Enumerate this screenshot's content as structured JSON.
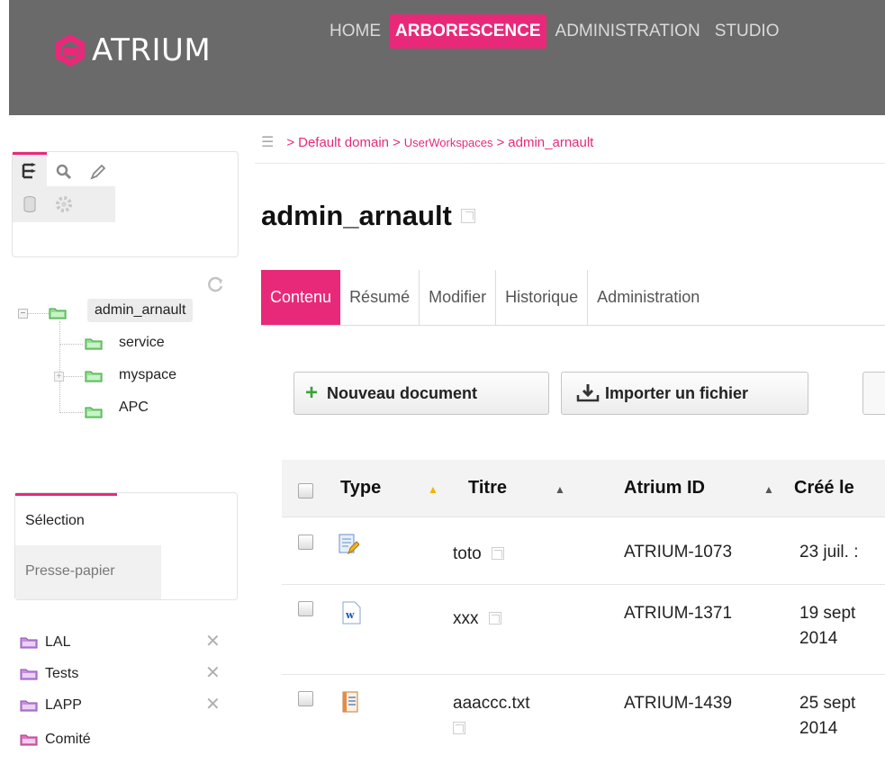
{
  "header": {
    "logo_text": "ATRIUM",
    "nav": [
      {
        "label": "HOME",
        "active": false
      },
      {
        "label": "ARBORESCENCE",
        "active": true
      },
      {
        "label": "ADMINISTRATION",
        "active": false
      },
      {
        "label": "STUDIO",
        "active": false
      }
    ]
  },
  "sidebar": {
    "tools": [
      "tree-icon",
      "search-icon",
      "pencil-icon",
      "database-icon",
      "settings-gear-icon"
    ],
    "tree": {
      "root": "admin_arnault",
      "children": [
        "service",
        "myspace",
        "APC"
      ]
    },
    "selection_tabs": {
      "active": "Sélection",
      "inactive": "Presse-papier"
    },
    "selection_items": [
      "LAL",
      "Tests",
      "LAPP",
      "Comité"
    ]
  },
  "breadcrumb": {
    "prefix": ">",
    "items": [
      "Default domain",
      "UserWorkspaces",
      "admin_arnault"
    ]
  },
  "page": {
    "title": "admin_arnault"
  },
  "tabs": [
    "Contenu",
    "Résumé",
    "Modifier",
    "Historique",
    "Administration"
  ],
  "actions": {
    "new_document": "Nouveau document",
    "import_file": "Importer un fichier"
  },
  "table": {
    "columns": [
      "Type",
      "Titre",
      "Atrium ID",
      "Créé le"
    ],
    "rows": [
      {
        "type_icon": "note-edit-icon",
        "title": "toto",
        "id": "ATRIUM-1073",
        "created": "23 juil. :"
      },
      {
        "type_icon": "word-document-icon",
        "title": "xxx",
        "id": "ATRIUM-1371",
        "created_line1": "19 sept",
        "created_line2": "2014"
      },
      {
        "type_icon": "text-file-icon",
        "title": "aaaccc.txt",
        "id": "ATRIUM-1439",
        "created_line1": "25 sept",
        "created_line2": "2014"
      }
    ]
  },
  "colors": {
    "accent": "#e8297a",
    "header_bg": "#6a6a6a"
  }
}
